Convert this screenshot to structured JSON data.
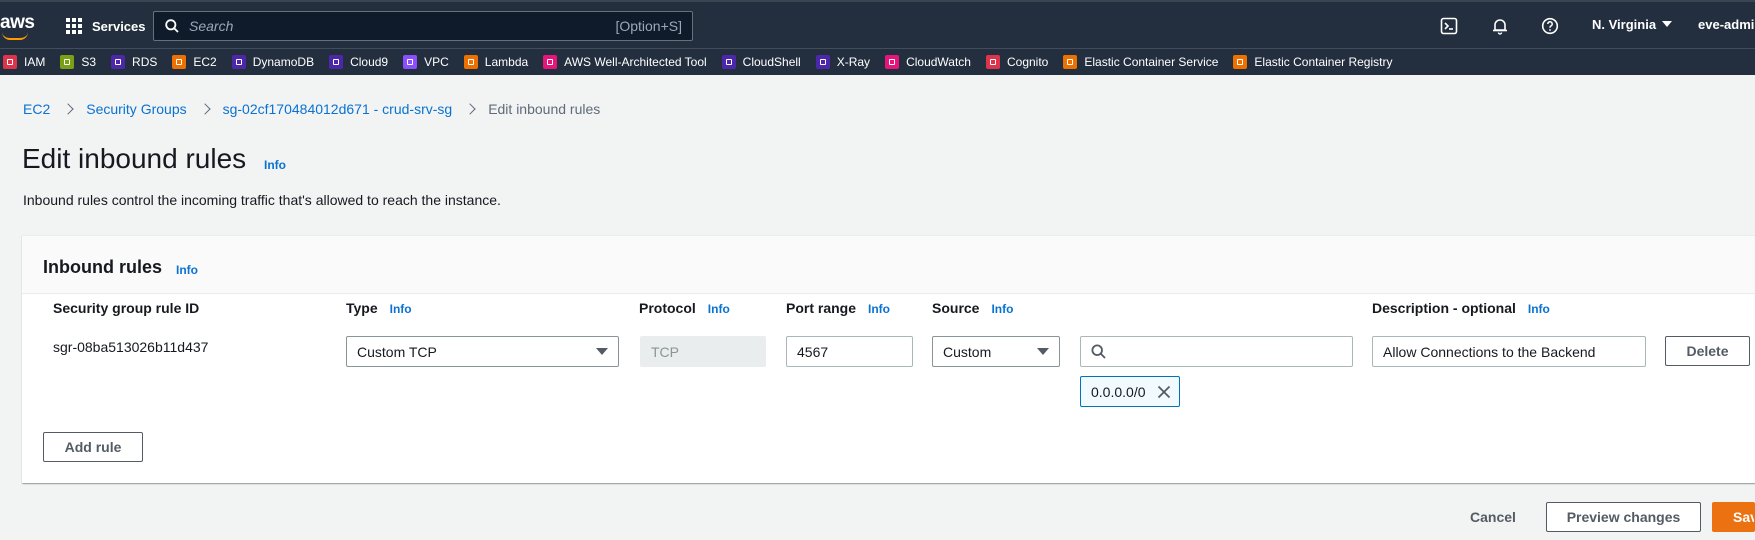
{
  "topnav": {
    "logo_text": "aws",
    "services_label": "Services",
    "search_placeholder": "Search",
    "search_shortcut": "[Option+S]",
    "region": "N. Virginia",
    "account": "eve-admin"
  },
  "favorites": [
    {
      "label": "IAM",
      "color": "#dd344c"
    },
    {
      "label": "S3",
      "color": "#7aa116"
    },
    {
      "label": "RDS",
      "color": "#4d27aa"
    },
    {
      "label": "EC2",
      "color": "#ed7100"
    },
    {
      "label": "DynamoDB",
      "color": "#4d27aa"
    },
    {
      "label": "Cloud9",
      "color": "#4d27aa"
    },
    {
      "label": "VPC",
      "color": "#8c4fff"
    },
    {
      "label": "Lambda",
      "color": "#ed7100"
    },
    {
      "label": "AWS Well-Architected Tool",
      "color": "#e7157b"
    },
    {
      "label": "CloudShell",
      "color": "#4d27aa"
    },
    {
      "label": "X-Ray",
      "color": "#4d27aa"
    },
    {
      "label": "CloudWatch",
      "color": "#e7157b"
    },
    {
      "label": "Cognito",
      "color": "#dd344c"
    },
    {
      "label": "Elastic Container Service",
      "color": "#ed7100"
    },
    {
      "label": "Elastic Container Registry",
      "color": "#ed7100"
    }
  ],
  "breadcrumb": {
    "items": [
      "EC2",
      "Security Groups",
      "sg-02cf170484012d671 - crud-srv-sg"
    ],
    "current": "Edit inbound rules"
  },
  "page": {
    "title": "Edit inbound rules",
    "info": "Info",
    "description": "Inbound rules control the incoming traffic that's allowed to reach the instance."
  },
  "panel": {
    "title": "Inbound rules",
    "info": "Info",
    "columns": {
      "rule_id": "Security group rule ID",
      "type": "Type",
      "protocol": "Protocol",
      "port_range": "Port range",
      "source": "Source",
      "description": "Description - optional",
      "info": "Info"
    },
    "rule": {
      "id": "sgr-08ba513026b11d437",
      "type": "Custom TCP",
      "protocol": "TCP",
      "port_range": "4567",
      "source": "Custom",
      "source_search": "",
      "source_token": "0.0.0.0/0",
      "description": "Allow Connections to the Backend",
      "delete_label": "Delete"
    },
    "add_rule_label": "Add rule"
  },
  "footer": {
    "cancel": "Cancel",
    "preview": "Preview changes",
    "save": "Save rules"
  }
}
